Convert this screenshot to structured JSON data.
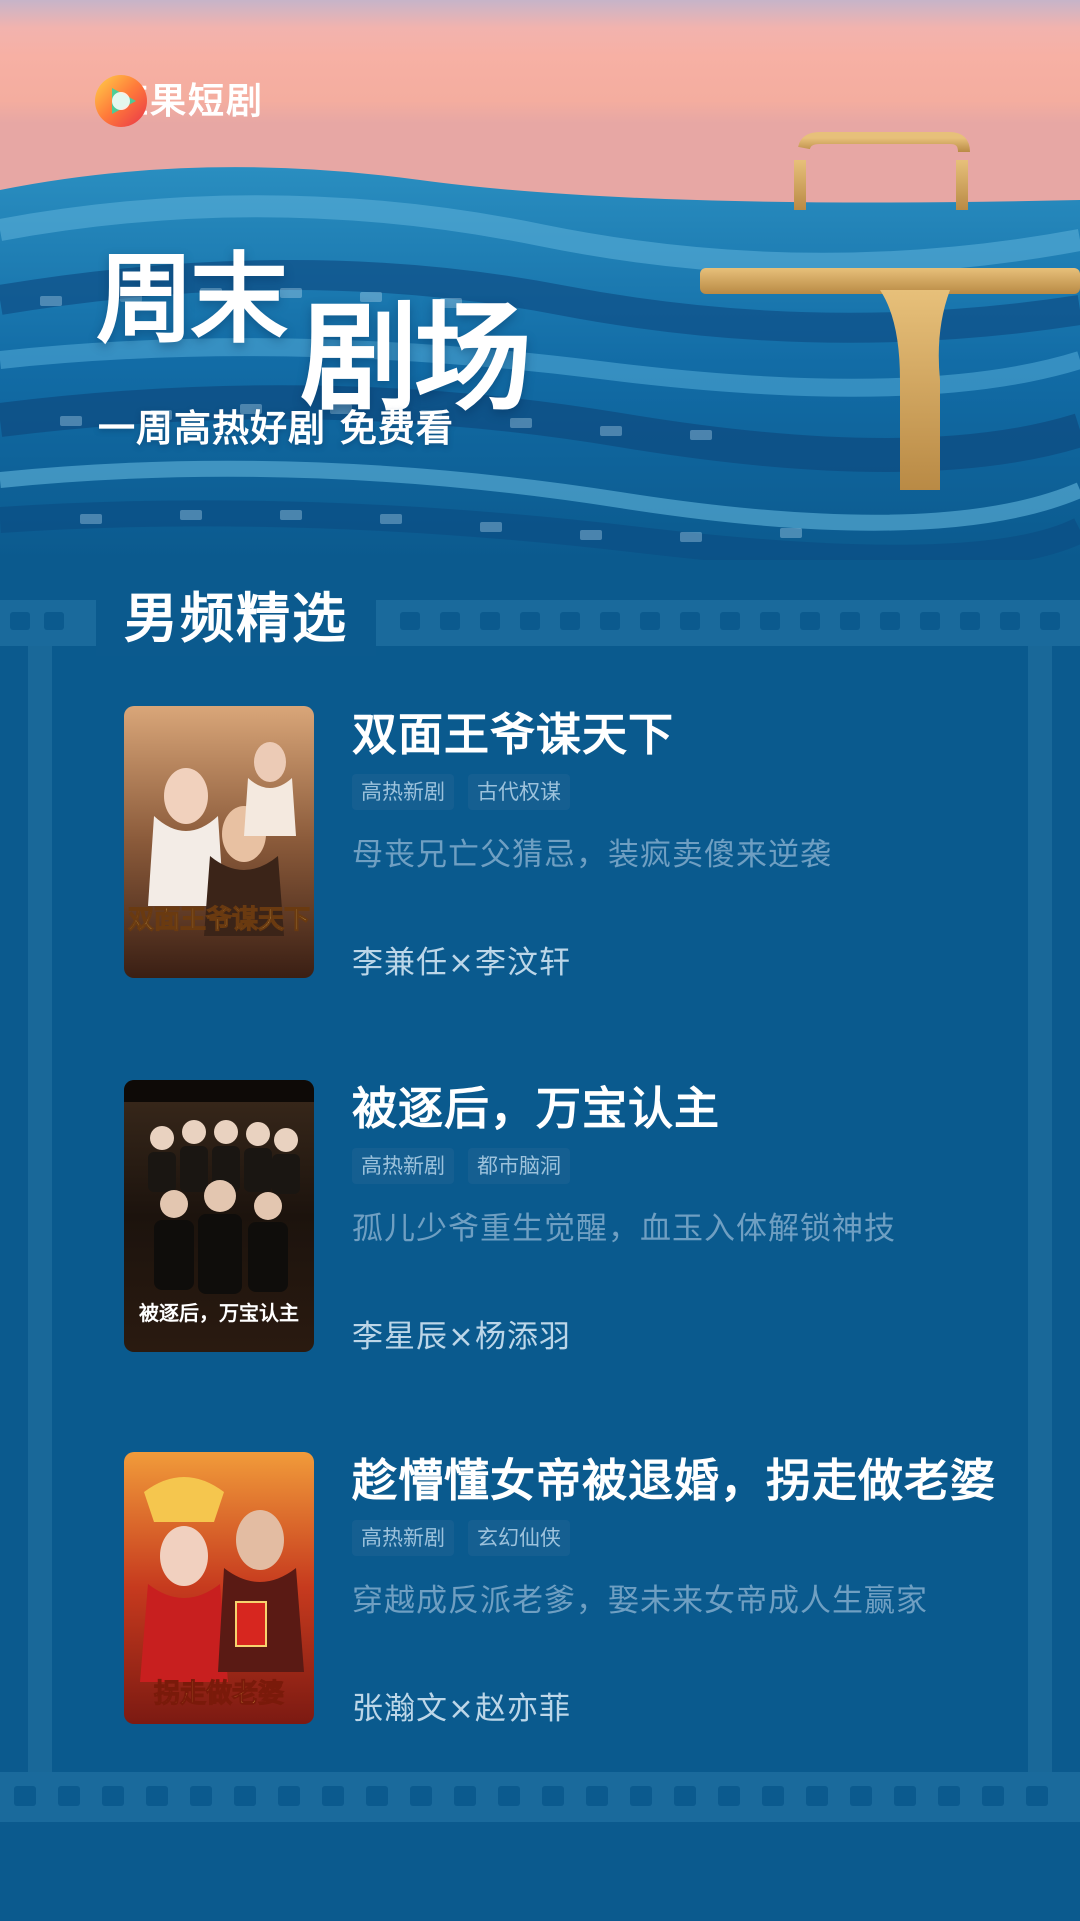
{
  "brand": {
    "name": "红果短剧",
    "accent": "#ff6a3d"
  },
  "hero": {
    "title_part1": "周末",
    "title_part2": "剧场",
    "subtitle": "一周高热好剧 免费看"
  },
  "section": {
    "title": "男频精选"
  },
  "dramas": [
    {
      "title": "双面王爷谋天下",
      "tags": [
        "高热新剧",
        "古代权谋"
      ],
      "description": "母丧兄亡父猜忌，装疯卖傻来逆袭",
      "cast": "李兼任×李汶轩",
      "poster_text": "双面王爷谋天下"
    },
    {
      "title": "被逐后，万宝认主",
      "tags": [
        "高热新剧",
        "都市脑洞"
      ],
      "description": "孤儿少爷重生觉醒，血玉入体解锁神技",
      "cast": "李星辰×杨添羽",
      "poster_text": "被逐后，万宝认主"
    },
    {
      "title": "趁懵懂女帝被退婚，拐走做老婆",
      "tags": [
        "高热新剧",
        "玄幻仙侠"
      ],
      "description": "穿越成反派老爹，娶未来女帝成人生赢家",
      "cast": "张瀚文×赵亦菲",
      "poster_text": "拐走做老婆"
    }
  ],
  "colors": {
    "background": "#0b5a8e",
    "tag_bg": "#155f91",
    "tag_text": "#9cc2dc",
    "description_text": "#6f9fc2",
    "cast_text": "#bcd6e8"
  }
}
